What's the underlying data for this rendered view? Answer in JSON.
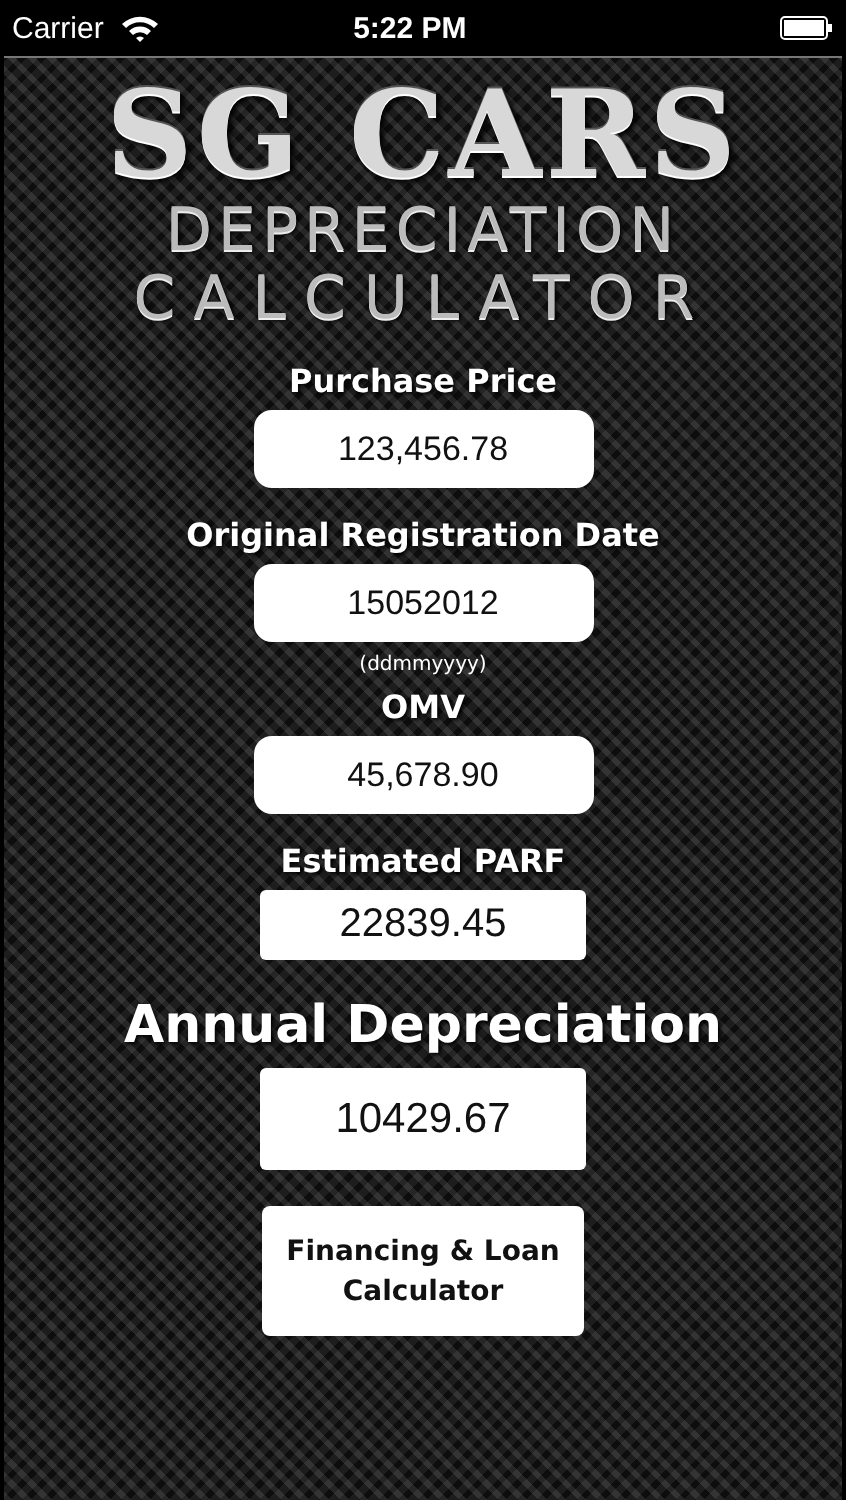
{
  "status_bar": {
    "carrier": "Carrier",
    "time": "5:22 PM"
  },
  "logo": {
    "title": "SG CARS",
    "line_1": "DEPRECIATION",
    "line_2": "CALCULATOR"
  },
  "fields": [
    {
      "kind": "input",
      "label": "Purchase Price",
      "value": "123,456.78"
    },
    {
      "kind": "input",
      "label": "Original Registration Date",
      "value": "15052012",
      "hint": "(ddmmyyyy)"
    },
    {
      "kind": "input",
      "label": "OMV",
      "value": "45,678.90"
    },
    {
      "kind": "output",
      "label": "Estimated PARF",
      "value": "22839.45"
    },
    {
      "kind": "result",
      "label": "Annual Depreciation",
      "value": "10429.67"
    }
  ],
  "button": "Financing & Loan Calculator"
}
